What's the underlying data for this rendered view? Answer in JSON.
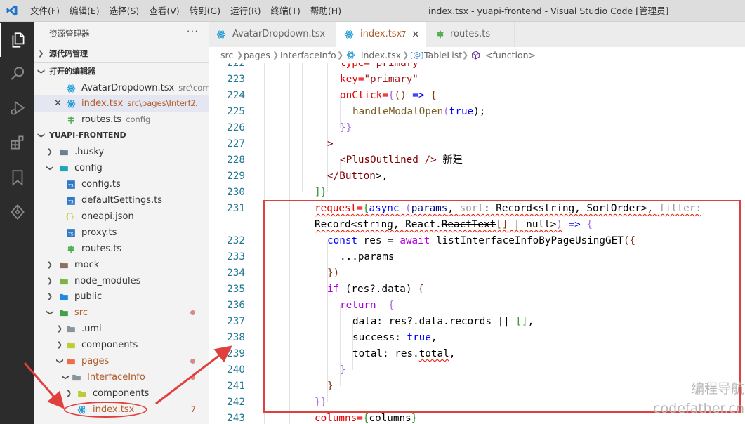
{
  "titlebar": {
    "menu": [
      "文件(F)",
      "编辑(E)",
      "选择(S)",
      "查看(V)",
      "转到(G)",
      "运行(R)",
      "终端(T)",
      "帮助(H)"
    ],
    "title": "index.tsx - yuapi-frontend - Visual Studio Code [管理员]"
  },
  "sidebar": {
    "title": "资源管理器",
    "more": "···",
    "sections": {
      "source_control": "源代码管理",
      "open_editors": "打开的编辑器",
      "project": "YUAPI-FRONTEND"
    },
    "open_editors": [
      {
        "name": "AvatarDropdown.tsx",
        "desc": "src\\com..."
      },
      {
        "name": "index.tsx",
        "desc": "src\\pages\\Interf...",
        "badge": "7"
      },
      {
        "name": "routes.ts",
        "desc": "config"
      }
    ],
    "tree": [
      {
        "name": ".husky"
      },
      {
        "name": "config"
      },
      {
        "name": "config.ts"
      },
      {
        "name": "defaultSettings.ts"
      },
      {
        "name": "oneapi.json"
      },
      {
        "name": "proxy.ts"
      },
      {
        "name": "routes.ts"
      },
      {
        "name": "mock"
      },
      {
        "name": "node_modules"
      },
      {
        "name": "public"
      },
      {
        "name": "src"
      },
      {
        "name": ".umi"
      },
      {
        "name": "components"
      },
      {
        "name": "pages"
      },
      {
        "name": "InterfaceInfo"
      },
      {
        "name": "components"
      },
      {
        "name": "index.tsx",
        "badge": "7"
      }
    ]
  },
  "tabs": [
    {
      "label": "AvatarDropdown.tsx"
    },
    {
      "label": "index.tsx",
      "badge": "7",
      "close": "×"
    },
    {
      "label": "routes.ts"
    }
  ],
  "breadcrumb": [
    "src",
    "pages",
    "InterfaceInfo",
    "index.tsx",
    "TableList",
    "<function>"
  ],
  "editor": {
    "line_numbers": [
      "222",
      "223",
      "224",
      "225",
      "226",
      "227",
      "228",
      "229",
      "230",
      "231",
      "",
      "232",
      "233",
      "234",
      "235",
      "236",
      "237",
      "238",
      "239",
      "240",
      "241",
      "242",
      "243"
    ],
    "code": {
      "l222a": "type=",
      "l222b": "\"primary\"",
      "l223a": "key=",
      "l223b": "\"primary\"",
      "l224a": "onClick=",
      "l224b": "{",
      "l224c": "()",
      "l224d": " => ",
      "l224e": "{",
      "l225a": "handleModalOpen",
      "l225b": "(",
      "l225c": "true",
      "l225d": ");",
      "l226": "}}",
      "l227": ">",
      "l228a": "<",
      "l228b": "PlusOutlined",
      "l228c": " />",
      "l228d": " 新建",
      "l229a": "</",
      "l229b": "Button",
      "l229c": ">,",
      "l230": "]}",
      "l231a": "request=",
      "l231b": "{",
      "l231c": "async",
      "l231d": " (",
      "l231e": "params",
      "l231f": ", ",
      "l231g": "sort",
      "l231h": ": Record<string, SortOrder>, ",
      "l231i": "filter:",
      "l231j": "Record<string, React.",
      "l231k": "ReactText",
      "l231l": "[]",
      "l231m": " | null>",
      "l231n": ")",
      "l231o": " => ",
      "l231p": "{",
      "l232a": "const",
      "l232b": " res = ",
      "l232c": "await",
      "l232d": " listInterfaceInfoByPageUsingGET",
      "l232e": "({",
      "l233": "...params",
      "l234": "})",
      "l235a": "if",
      "l235b": " (res?.data) ",
      "l235c": "{",
      "l236a": "return",
      "l236b": "  {",
      "l237a": "data: res?.data.records || ",
      "l237b": "[]",
      "l237c": ",",
      "l238a": "success: ",
      "l238b": "true",
      "l238c": ",",
      "l239a": "total: res.",
      "l239b": "total",
      "l239c": ",",
      "l240": "}",
      "l241": "}",
      "l242": "}}",
      "l243a": "columns=",
      "l243b": "{",
      "l243c": "columns",
      "l243d": "}"
    }
  },
  "watermark": {
    "line1": "编程导航",
    "line2": "codefather.cn"
  },
  "colors": {
    "accent_red": "#e0403d",
    "react_icon": "#1f9ad6",
    "ts_icon": "#3178c6",
    "json_icon": "#cbcb41"
  }
}
